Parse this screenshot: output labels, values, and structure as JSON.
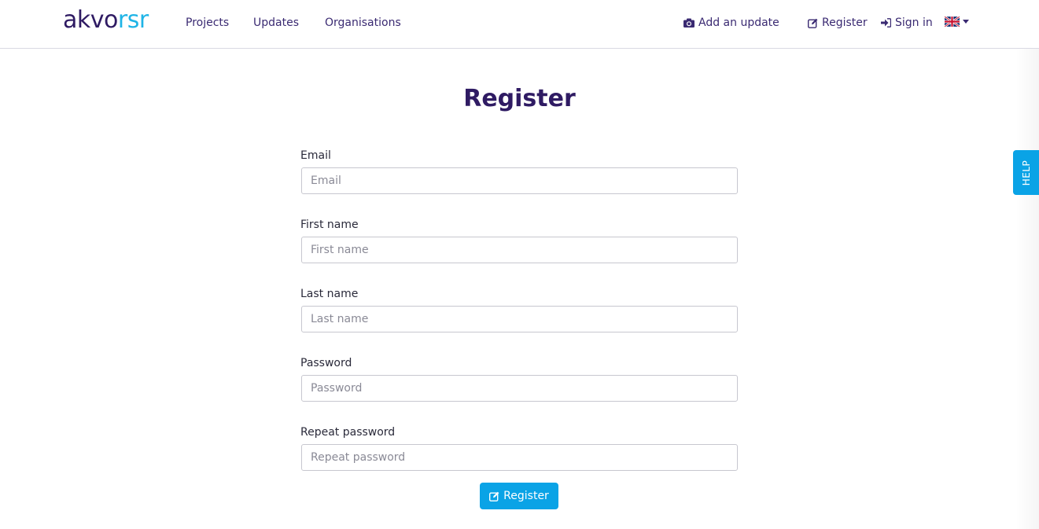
{
  "header": {
    "logo": {
      "part1": "akvo",
      "part2": "rsr"
    },
    "nav": {
      "projects": "Projects",
      "updates": "Updates",
      "organisations": "Organisations"
    },
    "actions": {
      "add_update": "Add an update",
      "register": "Register",
      "sign_in": "Sign in"
    },
    "language": {
      "icon": "uk-flag-icon"
    }
  },
  "main": {
    "title": "Register",
    "fields": {
      "email": {
        "label": "Email",
        "placeholder": "Email",
        "value": ""
      },
      "first_name": {
        "label": "First name",
        "placeholder": "First name",
        "value": ""
      },
      "last_name": {
        "label": "Last name",
        "placeholder": "Last name",
        "value": ""
      },
      "password": {
        "label": "Password",
        "placeholder": "Password",
        "value": ""
      },
      "repeat_password": {
        "label": "Repeat password",
        "placeholder": "Repeat password",
        "value": ""
      }
    },
    "submit_label": "Register"
  },
  "help": {
    "label": "HELP"
  },
  "colors": {
    "brand_dark": "#2f1b63",
    "brand_light": "#1fb4e6",
    "accent": "#0aa3e6"
  }
}
